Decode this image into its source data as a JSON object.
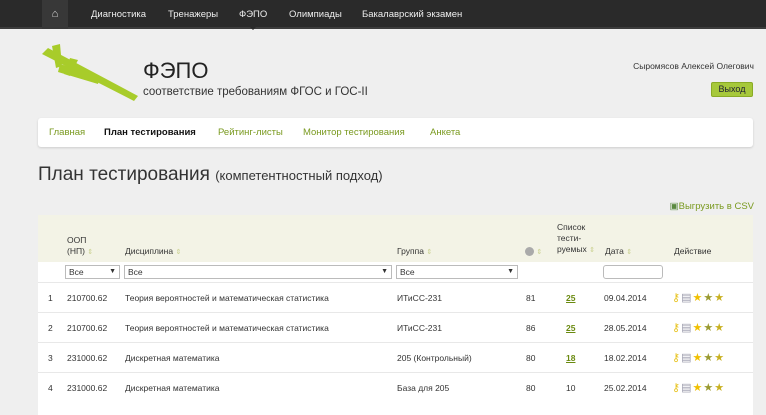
{
  "topnav": {
    "items": [
      "Диагностика",
      "Тренажеры",
      "ФЭПО",
      "Олимпиады",
      "Бакалаврский экзамен"
    ],
    "active": "ФЭПО"
  },
  "header": {
    "title": "ФЭПО",
    "subtitle": "соответствие требованиям ФГОС и ГОС-II",
    "user": "Сыромясов Алексей Олегович",
    "logout": "Выход"
  },
  "subnav": [
    "Главная",
    "План тестирования",
    "Рейтинг-листы",
    "Монитор тестирования",
    "Анкета"
  ],
  "page": {
    "title": "План тестирования",
    "subtitle": "(компетентностный подход)",
    "csv": "Выгрузить в CSV"
  },
  "table": {
    "headers": {
      "oop1": "ООП",
      "oop2": "(НП)",
      "discipline": "Дисциплина",
      "group": "Группа",
      "list1": "Список",
      "list2": "тести-",
      "list3": "руемых",
      "date": "Дата",
      "action": "Действие"
    },
    "filters": {
      "oop": "Все",
      "discipline": "Все",
      "group": "Все",
      "date": ""
    },
    "rows": [
      {
        "n": "1",
        "oop": "210700.62",
        "discipline": "Теория вероятностей и математическая статистика",
        "group": "ИТиСС-231",
        "count": "81",
        "list": "25",
        "list_link": true,
        "date": "09.04.2014"
      },
      {
        "n": "2",
        "oop": "210700.62",
        "discipline": "Теория вероятностей и математическая статистика",
        "group": "ИТиСС-231",
        "count": "86",
        "list": "25",
        "list_link": true,
        "date": "28.05.2014"
      },
      {
        "n": "3",
        "oop": "231000.62",
        "discipline": "Дискретная математика",
        "group": "205 (Контрольный)",
        "count": "80",
        "list": "18",
        "list_link": true,
        "date": "18.02.2014"
      },
      {
        "n": "4",
        "oop": "231000.62",
        "discipline": "Дискретная математика",
        "group": "База для 205",
        "count": "80",
        "list": "10",
        "list_link": false,
        "date": "25.02.2014"
      }
    ]
  }
}
